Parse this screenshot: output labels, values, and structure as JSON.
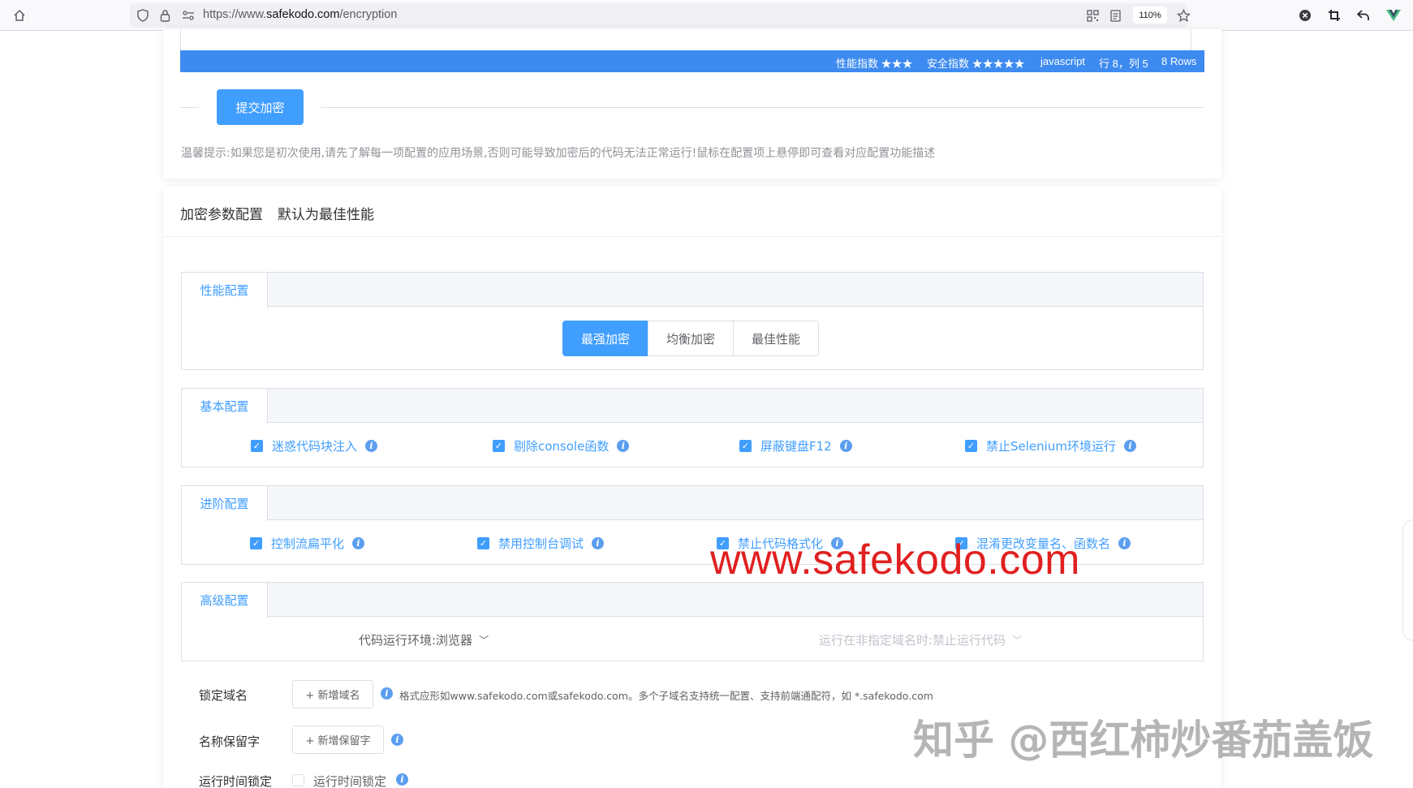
{
  "browser": {
    "url_prefix": "https://www.",
    "url_domain": "safekodo.com",
    "url_path": "/encryption",
    "zoom": "110%"
  },
  "editor_status": {
    "perf_label": "性能指数 ★★★",
    "security_label": "安全指数 ★★★★★",
    "language": "javascript",
    "position": "行 8，列 5",
    "rows": "8 Rows"
  },
  "submit_button": "提交加密",
  "hint": "温馨提示:如果您是初次使用,请先了解每一项配置的应用场景,否则可能导致加密后的代码无法正常运行!鼠标在配置项上悬停即可查看对应配置功能描述",
  "section": {
    "title": "加密参数配置",
    "subtitle": "默认为最佳性能"
  },
  "performance": {
    "tab": "性能配置",
    "options": [
      "最强加密",
      "均衡加密",
      "最佳性能"
    ],
    "selected": "最强加密"
  },
  "basic": {
    "tab": "基本配置",
    "items": [
      "迷惑代码块注入",
      "剔除console函数",
      "屏蔽键盘F12",
      "禁止Selenium环境运行"
    ]
  },
  "advanced": {
    "tab": "进阶配置",
    "items": [
      "控制流扁平化",
      "禁用控制台调试",
      "禁止代码格式化",
      "混淆更改变量名、函数名"
    ]
  },
  "expert": {
    "tab": "高级配置",
    "env_select": "代码运行环境:浏览器",
    "domain_select": "运行在非指定域名时:禁止运行代码"
  },
  "form": {
    "lock_domain_label": "锁定域名",
    "add_domain_button": "+ 新增域名",
    "domain_desc": "格式应形如www.safekodo.com或safekodo.com。多个子域名支持统一配置、支持前端通配符，如 *.safekodo.com",
    "reserved_label": "名称保留字",
    "add_reserved_button": "+ 新增保留字",
    "time_lock_label": "运行时间锁定",
    "time_lock_checkbox": "运行时间锁定"
  },
  "watermarks": {
    "site": "www.safekodo.com",
    "zhihu": "知乎 @西红柿炒番茄盖饭"
  }
}
